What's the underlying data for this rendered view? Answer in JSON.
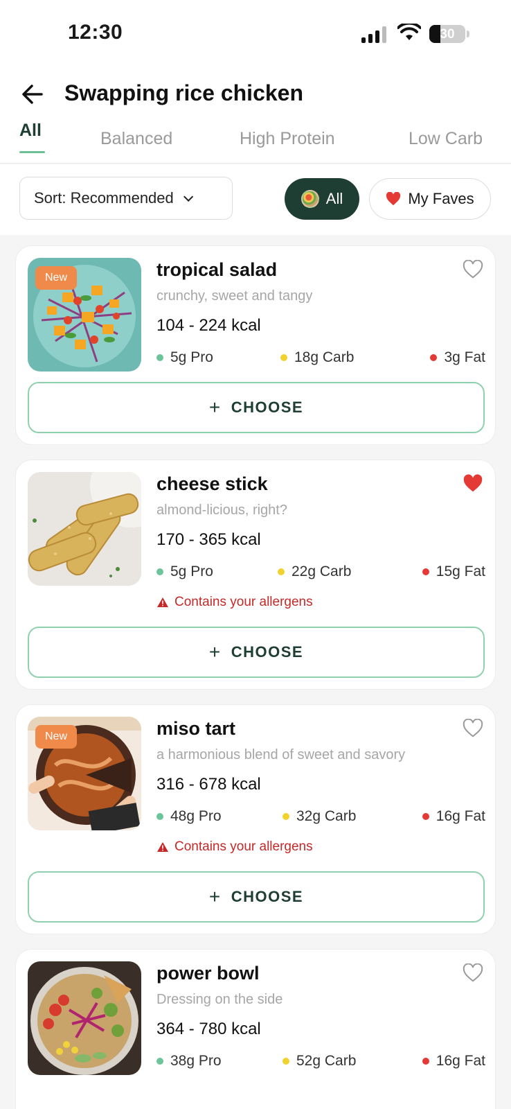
{
  "status_bar": {
    "time": "12:30",
    "battery": "30",
    "battery_level": 0.3
  },
  "header": {
    "title": "Swapping rice chicken"
  },
  "tabs": [
    {
      "label": "All",
      "active": true
    },
    {
      "label": "Balanced",
      "active": false
    },
    {
      "label": "High Protein",
      "active": false
    },
    {
      "label": "Low Carb",
      "active": false
    }
  ],
  "filters": {
    "sort_label": "Sort: Recommended",
    "all_label": "All",
    "faves_label": "My Faves"
  },
  "colors": {
    "primary": "#1e3d33",
    "accent": "#6dbd95",
    "badge": "#f08a4b",
    "protein": "#6cc49a",
    "carb": "#f2d22e",
    "fat": "#e53935",
    "allergen": "#c62828"
  },
  "choose_label": "CHOOSE",
  "items": [
    {
      "name": "tropical salad",
      "description": "crunchy, sweet and tangy",
      "kcal": "104 - 224 kcal",
      "protein": "5g Pro",
      "carb": "18g Carb",
      "fat": "3g Fat",
      "badge": "New",
      "favorite": false,
      "allergen": ""
    },
    {
      "name": "cheese stick",
      "description": "almond-licious, right?",
      "kcal": "170 - 365 kcal",
      "protein": "5g Pro",
      "carb": "22g Carb",
      "fat": "15g Fat",
      "badge": "",
      "favorite": true,
      "allergen": "Contains your allergens"
    },
    {
      "name": "miso tart",
      "description": "a harmonious blend of sweet and savory",
      "kcal": "316 - 678 kcal",
      "protein": "48g Pro",
      "carb": "32g Carb",
      "fat": "16g Fat",
      "badge": "New",
      "favorite": false,
      "allergen": "Contains your allergens"
    },
    {
      "name": "power bowl",
      "description": "Dressing on the side",
      "kcal": "364 - 780 kcal",
      "protein": "38g Pro",
      "carb": "52g Carb",
      "fat": "16g Fat",
      "badge": "",
      "favorite": false,
      "allergen": ""
    }
  ]
}
